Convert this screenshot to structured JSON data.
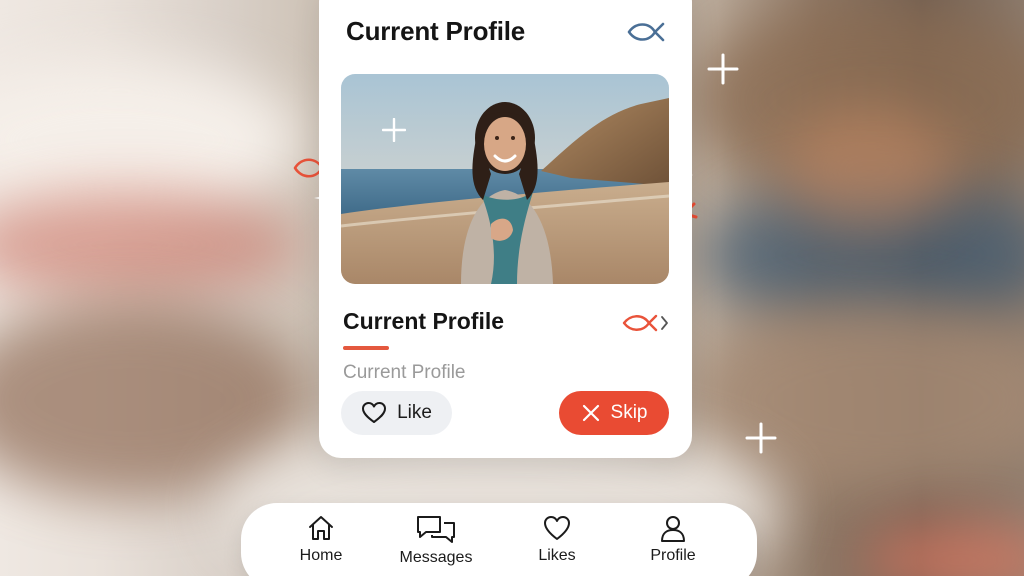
{
  "card": {
    "title": "Current Profile",
    "profile_name": "Current Profile",
    "subtitle": "Current Profile",
    "like_label": "Like",
    "skip_label": "Skip"
  },
  "nav": {
    "items": [
      {
        "label": "Home",
        "icon": "home-icon"
      },
      {
        "label": "Messages",
        "icon": "messages-icon"
      },
      {
        "label": "Likes",
        "icon": "heart-icon"
      },
      {
        "label": "Profile",
        "icon": "user-icon"
      }
    ]
  },
  "colors": {
    "accent": "#e94b33",
    "accent_bar": "#e4583e",
    "fish_blue": "#4a6f96",
    "text_primary": "#151515",
    "text_muted": "#9a9a9a",
    "like_bg": "#eef0f3"
  }
}
